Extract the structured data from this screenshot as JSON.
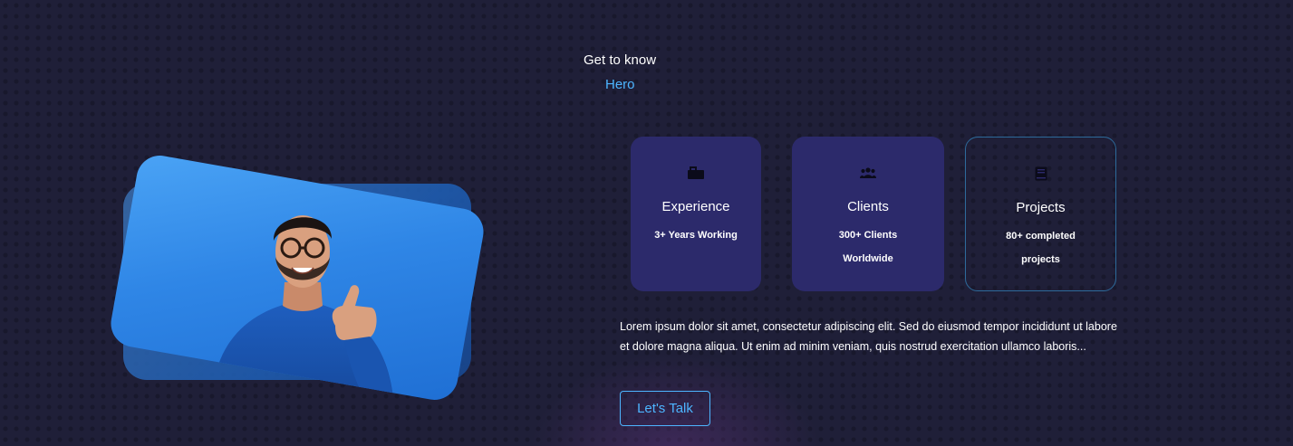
{
  "header": {
    "subtitle": "Get to know",
    "title": "Hero"
  },
  "about": {
    "image_icon": "portrait-photo",
    "cards": [
      {
        "icon": "briefcase-icon",
        "title": "Experience",
        "line1": "3+ Years Working",
        "line2": ""
      },
      {
        "icon": "users-icon",
        "title": "Clients",
        "line1": "300+ Clients",
        "line2": "Worldwide"
      },
      {
        "icon": "book-icon",
        "title": "Projects",
        "line1": "80+ completed",
        "line2": "projects"
      }
    ],
    "paragraph": "Lorem ipsum dolor sit amet, consectetur adipiscing elit. Sed do eiusmod tempor incididunt ut labore et dolore magna aliqua. Ut enim ad minim veniam, quis nostrud exercitation ullamco laboris...",
    "cta_label": "Let's Talk"
  },
  "colors": {
    "background": "#1f1f38",
    "accent": "#4db5ff",
    "card_bg": "#2c2a6b",
    "card_border": "#2d6a9a"
  }
}
